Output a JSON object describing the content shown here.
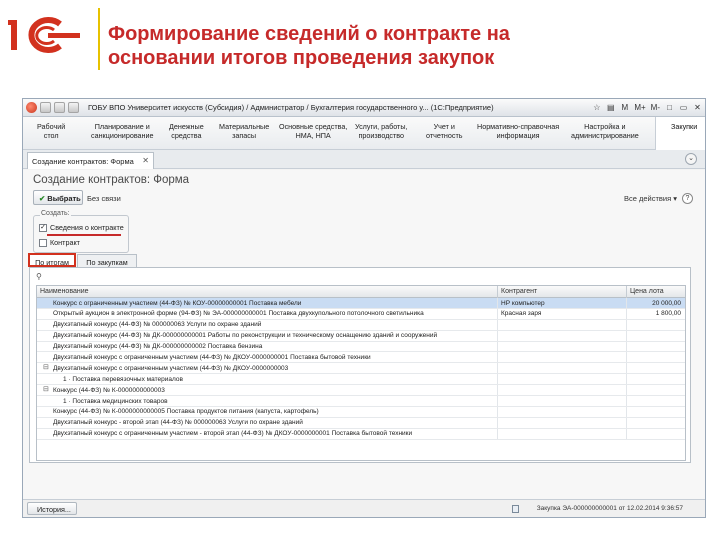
{
  "slide": {
    "title_line1": "Формирование сведений о контракте на",
    "title_line2": "основании итогов проведения закупок",
    "logo_text": "1С"
  },
  "colors": {
    "title": "#c62a2a",
    "logo": "#d2311e",
    "accent_divider": "#e7c200",
    "selected_row": "#c9dcf3"
  },
  "window": {
    "title": "ГОБУ ВПО Университет искусств (Субсидия) / Администратор / Бухгалтерия государственного у... (1С:Предприятие)",
    "title_controls": [
      "M",
      "M+",
      "M-",
      "□",
      "▭",
      "✕"
    ]
  },
  "sections": [
    {
      "label": "Рабочий\nстол"
    },
    {
      "label": "Планирование и\nсанкционирование"
    },
    {
      "label": "Денежные\nсредства"
    },
    {
      "label": "Материальные\nзапасы"
    },
    {
      "label": "Основные средства,\nНМА, НПА"
    },
    {
      "label": "Услуги, работы,\nпроизводство"
    },
    {
      "label": "Учет и\nотчетность"
    },
    {
      "label": "Нормативно-справочная\nинформация"
    },
    {
      "label": "Настройка и\nадминистрирование"
    },
    {
      "label": "Закупки"
    }
  ],
  "doc_tab": {
    "label": "Создание контрактов: Форма",
    "close": "✕"
  },
  "form": {
    "title": "Создание контрактов: Форма",
    "select_button": "Выбрать",
    "no_link": "Без связи",
    "more_actions": "Все действия ▾",
    "help": "?",
    "group_label": "Создать:",
    "checkbox1": {
      "label": "Сведения о контракте",
      "checked": true
    },
    "checkbox2": {
      "label": "Контракт",
      "checked": false
    },
    "subtabs": [
      "По итогам",
      "По закупкам"
    ]
  },
  "table": {
    "headers": [
      "Наименование",
      "Контрагент",
      "Цена лота"
    ],
    "rows": [
      {
        "name": "Конкурс с ограниченным участием (44-ФЗ) № КОУ-00000000001 Поставка мебели",
        "contractor": "НР компьютер",
        "price": "20 000,00",
        "selected": true,
        "indent": 0,
        "tree": ""
      },
      {
        "name": "Открытый аукцион в электронной форме (94-ФЗ) № ЭА-000000000001 Поставка двухкупольного потолочного светильника",
        "contractor": "Красная заря",
        "price": "1 800,00",
        "selected": false,
        "indent": 0,
        "tree": ""
      },
      {
        "name": "Двухэтапный конкурс (44-ФЗ) № 000000063 Услуги по охране зданий",
        "contractor": "",
        "price": "",
        "selected": false,
        "indent": 0,
        "tree": ""
      },
      {
        "name": "Двухэтапный конкурс (44-ФЗ) № ДК-000000000001 Работы по реконструкции и техническому оснащению зданий и сооружений",
        "contractor": "",
        "price": "",
        "selected": false,
        "indent": 0,
        "tree": ""
      },
      {
        "name": "Двухэтапный конкурс (44-ФЗ) № ДК-000000000002 Поставка бензина",
        "contractor": "",
        "price": "",
        "selected": false,
        "indent": 0,
        "tree": ""
      },
      {
        "name": "Двухэтапный конкурс с ограниченным участием (44-ФЗ) № ДКОУ-0000000001 Поставка бытовой техники",
        "contractor": "",
        "price": "",
        "selected": false,
        "indent": 0,
        "tree": ""
      },
      {
        "name": "Двухэтапный конкурс с ограниченным участием (44-ФЗ) № ДКОУ-0000000003",
        "contractor": "",
        "price": "",
        "selected": false,
        "indent": 0,
        "tree": "⊟"
      },
      {
        "name": "1 · Поставка перевязочных материалов",
        "contractor": "",
        "price": "",
        "selected": false,
        "indent": 1,
        "tree": ""
      },
      {
        "name": "Конкурс (44-ФЗ) № К-0000000000003",
        "contractor": "",
        "price": "",
        "selected": false,
        "indent": 0,
        "tree": "⊟"
      },
      {
        "name": "1 · Поставка медицинских товаров",
        "contractor": "",
        "price": "",
        "selected": false,
        "indent": 1,
        "tree": ""
      },
      {
        "name": "Конкурс (44-ФЗ) № К-0000000000005 Поставка продуктов питания (капуста, картофель)",
        "contractor": "",
        "price": "",
        "selected": false,
        "indent": 0,
        "tree": ""
      },
      {
        "name": "Двухэтапный конкурс - второй этап (44-ФЗ) № 000000063 Услуги по охране зданий",
        "contractor": "",
        "price": "",
        "selected": false,
        "indent": 0,
        "tree": ""
      },
      {
        "name": "Двухэтапный конкурс с ограниченным участием - второй этап (44-ФЗ) № ДКОУ-0000000001 Поставка бытовой техники",
        "contractor": "",
        "price": "",
        "selected": false,
        "indent": 0,
        "tree": ""
      }
    ]
  },
  "statusbar": {
    "history": "История...",
    "text": "Закупка ЭА-000000000001 от 12.02.2014 9:36:57"
  }
}
